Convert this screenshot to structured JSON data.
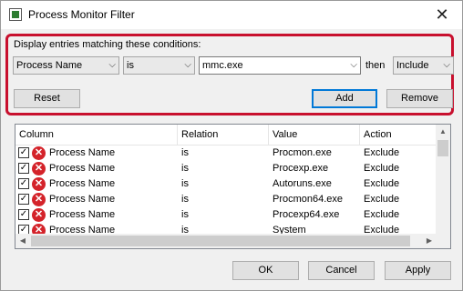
{
  "window": {
    "title": "Process Monitor Filter",
    "close_glyph": "✕"
  },
  "filter": {
    "label": "Display entries matching these conditions:",
    "column_value": "Process Name",
    "relation_value": "is",
    "value_text": "mmc.exe",
    "then_label": "then",
    "action_value": "Include",
    "reset_label": "Reset",
    "add_label": "Add",
    "remove_label": "Remove"
  },
  "table": {
    "headers": [
      "Column",
      "Relation",
      "Value",
      "Action"
    ],
    "rows": [
      {
        "column": "Process Name",
        "relation": "is",
        "value": "Procmon.exe",
        "action": "Exclude"
      },
      {
        "column": "Process Name",
        "relation": "is",
        "value": "Procexp.exe",
        "action": "Exclude"
      },
      {
        "column": "Process Name",
        "relation": "is",
        "value": "Autoruns.exe",
        "action": "Exclude"
      },
      {
        "column": "Process Name",
        "relation": "is",
        "value": "Procmon64.exe",
        "action": "Exclude"
      },
      {
        "column": "Process Name",
        "relation": "is",
        "value": "Procexp64.exe",
        "action": "Exclude"
      },
      {
        "column": "Process Name",
        "relation": "is",
        "value": "System",
        "action": "Exclude"
      }
    ]
  },
  "footer": {
    "ok_label": "OK",
    "cancel_label": "Cancel",
    "apply_label": "Apply"
  },
  "colors": {
    "highlight_border": "#c8102e",
    "exclude_icon": "#d4232a",
    "default_button": "#0078d7"
  }
}
